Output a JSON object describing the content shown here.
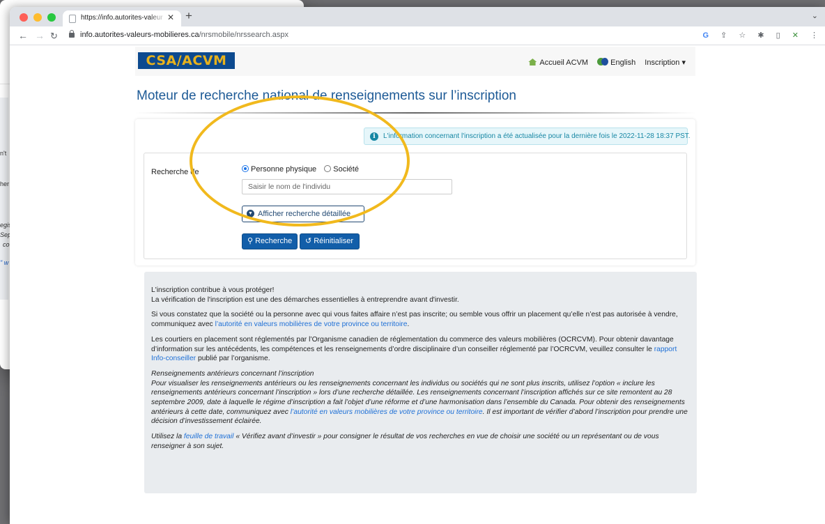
{
  "background_window": {
    "fragments": [
      "n't",
      "her",
      "egis",
      "Sep",
      "co",
      "\" w"
    ]
  },
  "browser": {
    "tab_title": "https://info.autorites-valeurs-mobilieres.ca",
    "url_host": "info.autorites-valeurs-mobilieres.ca",
    "url_path": "/nrsmobile/nrssearch.aspx"
  },
  "header": {
    "logo_text": "CSA/ACVM",
    "nav": {
      "home": "Accueil ACVM",
      "english": "English",
      "inscription": "Inscription ▾"
    }
  },
  "page": {
    "title": "Moteur de recherche national de renseignements sur l’inscription"
  },
  "search": {
    "info_alert": "L'information concernant l'inscription a été actualisée pour la dernière fois le 2022-11-28 18:37 PST.",
    "label": "Recherche de",
    "options": [
      "Personne physique",
      "Société"
    ],
    "selected": "Personne physique",
    "name_placeholder": "Saisir le nom de l'individu",
    "detail_button": "Afficher recherche détaillée",
    "search_button": "Recherche",
    "reset_button": "Réinitialiser"
  },
  "info": {
    "p1_line1": "L'inscription contribue à vous protéger!",
    "p1_line2": "La vérification de l'inscription est une des démarches essentielles à entreprendre avant d'investir.",
    "p2_text": "Si vous constatez que la société ou la personne avec qui vous faites affaire n’est pas inscrite; ou semble vous offrir un placement qu’elle n’est pas autorisée à vendre, communiquez avec ",
    "p2_link": "l’autorité en valeurs mobilières de votre province ou territoire",
    "p2_end": ".",
    "p3_text": "Les courtiers en placement sont réglementés par l’Organisme canadien de réglementation du commerce des valeurs mobilières (OCRCVM). Pour obtenir davantage d’information sur les antécédents, les compétences et les renseignements d’ordre disciplinaire d’un conseiller réglementé par l’OCRCVM, veuillez consulter le ",
    "p3_link": "rapport Info-conseiller",
    "p3_end": " publié par l’organisme.",
    "p4_heading": "Renseignements antérieurs concernant l’inscription",
    "p4_text": "Pour visualiser les renseignements antérieurs ou les renseignements concernant les individus ou sociétés qui ne sont plus inscrits, utilisez l’option « inclure les renseignements antérieurs concernant l’inscription » lors d’une recherche détaillée. Les renseignements concernant l’inscription affichés sur ce site remontent au 28 septembre 2009, date à laquelle le régime d’inscription a fait l’objet d’une réforme et d’une harmonisation dans l’ensemble du Canada. Pour obtenir des renseignements antérieurs à cette date, communiquez avec ",
    "p4_link": "l’autorité en valeurs mobilières de votre province ou territoire",
    "p4_end": ". Il est important de vérifier d’abord l’inscription pour prendre une décision d’investissement éclairée.",
    "p5_start": "Utilisez la ",
    "p5_link": "feuille de travail",
    "p5_end": " « Vérifiez avant d’investir » pour consigner le résultat de vos recherches en vue de choisir une société ou un représentant ou de vous renseigner à son sujet."
  },
  "colors": {
    "brand_blue": "#125ea9",
    "title_blue": "#1d5a96",
    "highlight": "#f1b91d",
    "alert_text": "#1787a4"
  }
}
